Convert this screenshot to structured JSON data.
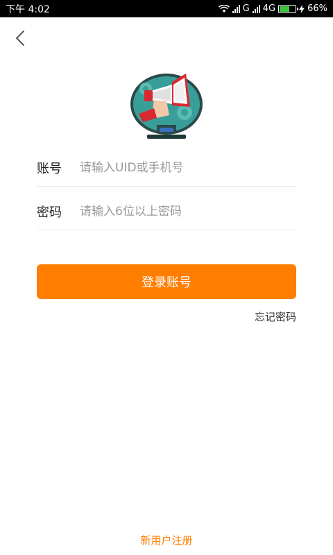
{
  "status_bar": {
    "time": "下午 4:02",
    "network_g": "G",
    "network_4g": "4G",
    "battery_percent": "66%",
    "battery_level": 0.66
  },
  "form": {
    "account": {
      "label": "账号",
      "placeholder": "请输入UID或手机号",
      "value": ""
    },
    "password": {
      "label": "密码",
      "placeholder": "请输入6位以上密码",
      "value": ""
    }
  },
  "actions": {
    "login_label": "登录账号",
    "forgot_label": "忘记密码",
    "register_label": "新用户注册"
  },
  "colors": {
    "accent": "#ff7e00",
    "status_bar_bg": "#000000",
    "divider": "#e8e8e8"
  },
  "icons": {
    "back": "chevron-left-icon",
    "hero": "megaphone-monitor-illustration"
  }
}
